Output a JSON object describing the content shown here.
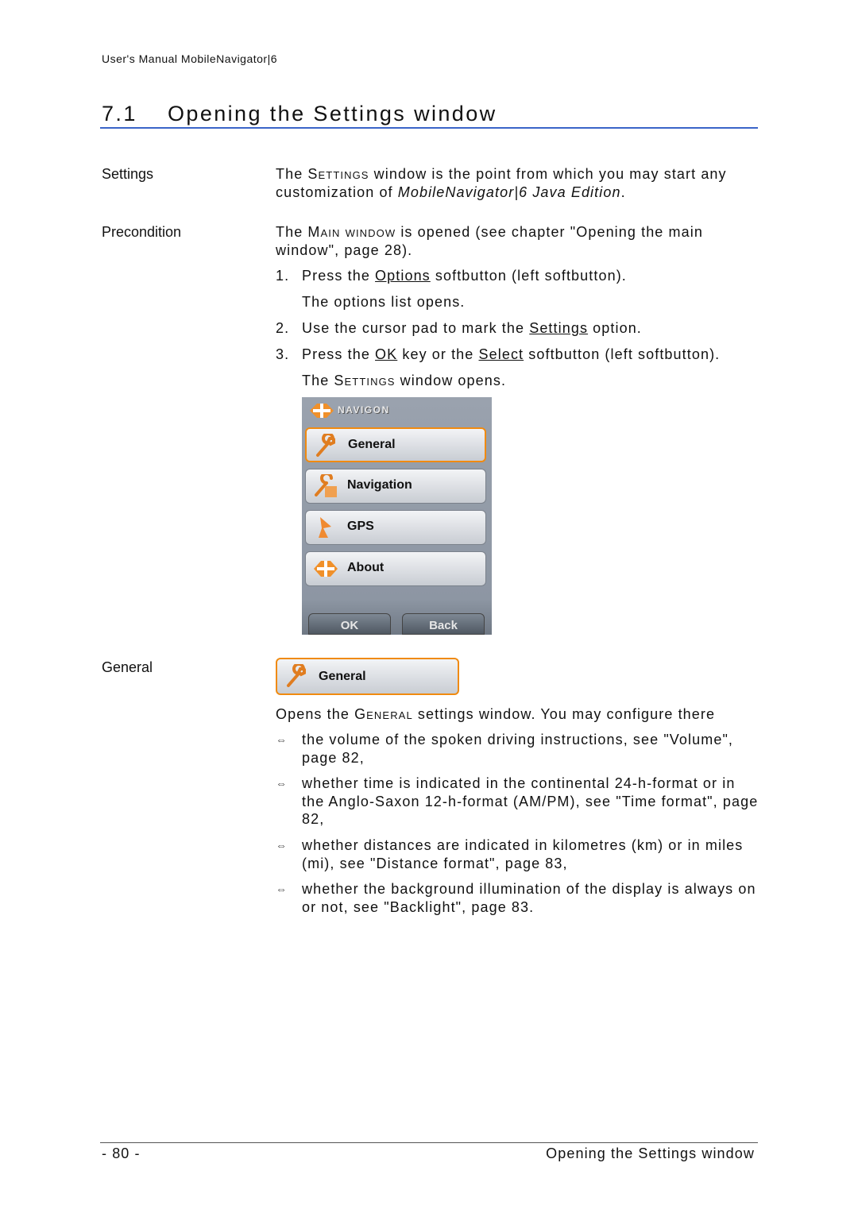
{
  "header": {
    "running_title": "User's Manual MobileNavigator|6"
  },
  "section": {
    "number": "7.1",
    "title": "Opening the Settings window"
  },
  "settings": {
    "label": "Settings",
    "text_a": "The ",
    "text_sc": "Settings",
    "text_b": " window is the point from which you may start any customization of ",
    "text_i": "MobileNavigator|6 Java Edition",
    "text_c": "."
  },
  "precondition": {
    "label": "Precondition",
    "text_a": "The ",
    "text_sc": "Main window",
    "text_b": " is opened (see chapter \"Opening the main window\", page 28)."
  },
  "steps": [
    {
      "n": "1.",
      "a": "Press the ",
      "u": "Options",
      "b": " softbutton (left softbutton)."
    },
    {
      "result": "The options list opens."
    },
    {
      "n": "2.",
      "a": "Use the cursor pad to mark the ",
      "u": "Settings",
      "b": " option."
    },
    {
      "n": "3.",
      "a": "Press the ",
      "u": "OK",
      "b": " key or the ",
      "u2": "Select",
      "c": " softbutton (left softbutton)."
    },
    {
      "result_a": "The ",
      "result_sc": "Settings",
      "result_b": " window opens."
    }
  ],
  "screen": {
    "brand": "NAVIGON",
    "menu": [
      {
        "label": "General",
        "icon": "wrench-icon",
        "selected": true
      },
      {
        "label": "Navigation",
        "icon": "wrench-map-icon",
        "selected": false
      },
      {
        "label": "GPS",
        "icon": "satellite-dish-icon",
        "selected": false
      },
      {
        "label": "About",
        "icon": "navigon-logo-icon",
        "selected": false
      }
    ],
    "ok": "OK",
    "back": "Back",
    "accent": "#f08a10"
  },
  "general": {
    "label": "General",
    "button": "General",
    "intro_a": "Opens the ",
    "intro_sc": "General",
    "intro_b": " settings window. You may configure there",
    "bullets": [
      "the volume of the spoken driving instructions, see \"Volume\", page 82,",
      "whether time is indicated in the continental 24-h-format or in the Anglo-Saxon 12-h-format (AM/PM), see \"Time format\", page 82,",
      "whether distances are indicated in kilometres (km) or in miles (mi), see \"Distance format\", page 83,",
      "whether the background illumination of the display is always on or not, see \"Backlight\", page 83."
    ],
    "bullet_icon": "double-arrow-icon"
  },
  "footer": {
    "page": "- 80 -",
    "title": "Opening the Settings window"
  }
}
